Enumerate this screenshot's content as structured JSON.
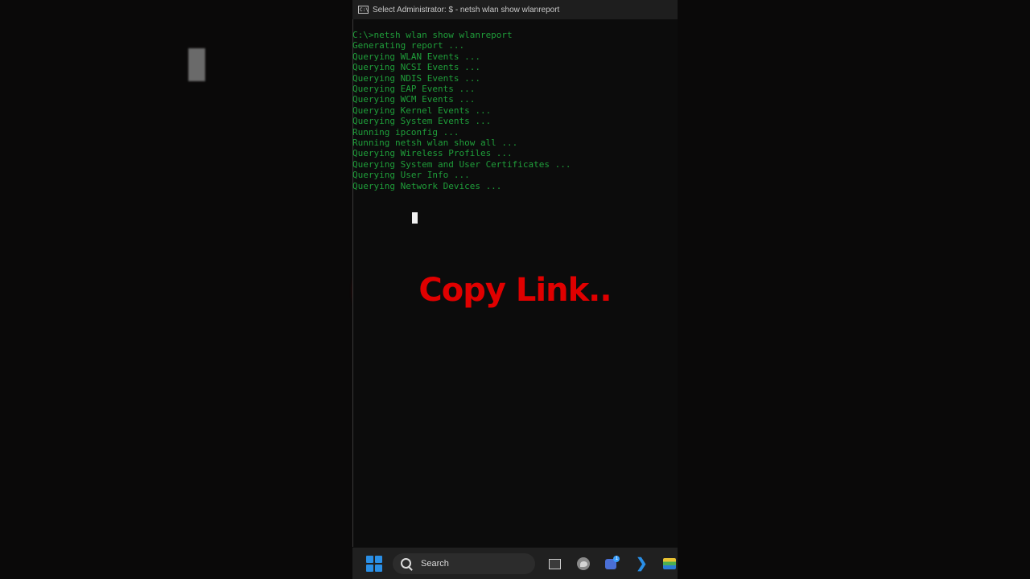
{
  "background": {
    "blurred_text": "Co                     k..",
    "accent_color": "#5c0606"
  },
  "window": {
    "title": "Select Administrator: $ - netsh  wlan show wlanreport",
    "icon": "terminal-icon",
    "terminal_color": "#1f9e3a",
    "lines": [
      "C:\\>netsh wlan show wlanreport",
      "Generating report ...",
      "Querying WLAN Events ...",
      "Querying NCSI Events ...",
      "Querying NDIS Events ...",
      "Querying EAP Events ...",
      "Querying WCM Events ...",
      "Querying Kernel Events ...",
      "Querying System Events ...",
      "Running ipconfig ...",
      "Running netsh wlan show all ...",
      "Querying Wireless Profiles ...",
      "Querying System and User Certificates ...",
      "Querying User Info ...",
      "Querying Network Devices ..."
    ]
  },
  "overlay": {
    "caption": "Copy Link..",
    "color": "#e00000"
  },
  "taskbar": {
    "start_icon": "windows-start-icon",
    "search_label": "Search",
    "chat_badge": "1",
    "icons": [
      "task-view-icon",
      "edge-icon",
      "chat-icon",
      "vscode-icon",
      "layers-app-icon"
    ]
  }
}
